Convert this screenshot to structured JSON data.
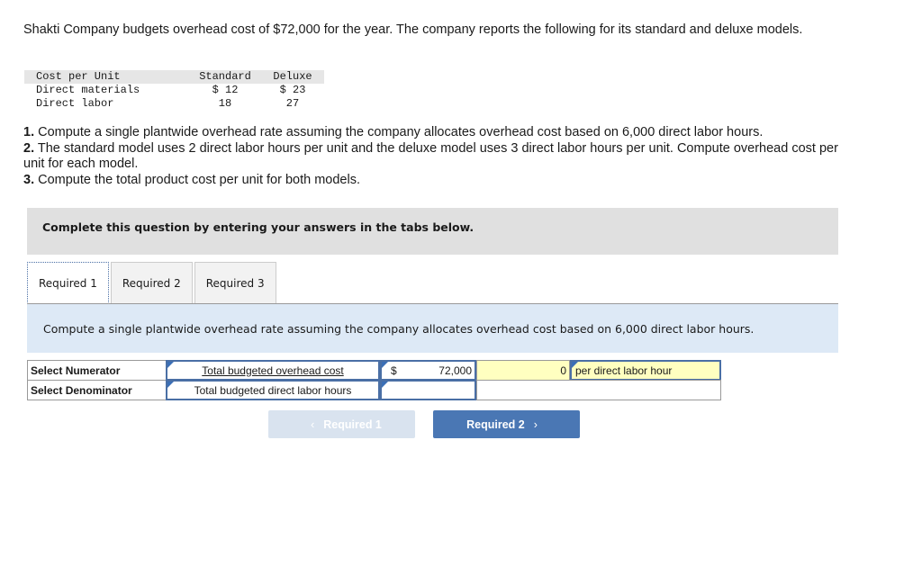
{
  "intro": "Shakti Company budgets overhead cost of $72,000 for the year. The company reports the following for its standard and deluxe models.",
  "cost_table": {
    "headers": [
      "Cost per Unit",
      "Standard",
      "Deluxe"
    ],
    "rows": [
      [
        "Direct materials",
        "$ 12",
        "$ 23"
      ],
      [
        "Direct labor",
        "18",
        "27"
      ]
    ]
  },
  "questions": [
    {
      "num": "1.",
      "text": " Compute a single plantwide overhead rate assuming the company allocates overhead cost based on 6,000 direct labor hours."
    },
    {
      "num": "2.",
      "text": " The standard model uses 2 direct labor hours per unit and the deluxe model uses 3 direct labor hours per unit. Compute overhead cost per unit for each model."
    },
    {
      "num": "3.",
      "text": " Compute the total product cost per unit for both models."
    }
  ],
  "banner": "Complete this question by entering your answers in the tabs below.",
  "tabs": [
    {
      "label": "Required 1",
      "active": true
    },
    {
      "label": "Required 2",
      "active": false
    },
    {
      "label": "Required 3",
      "active": false
    }
  ],
  "instruction": "Compute a single plantwide overhead rate assuming the company allocates overhead cost based on 6,000 direct labor hours.",
  "rate_grid": {
    "numerator_label": "Select Numerator",
    "numerator_select": "Total budgeted overhead cost",
    "numerator_currency": "$",
    "numerator_value": "72,000",
    "result_value": "0",
    "result_unit": "per direct labor hour",
    "denominator_label": "Select Denominator",
    "denominator_select": "Total budgeted direct labor hours",
    "denominator_value": ""
  },
  "nav": {
    "prev_label": "Required 1",
    "next_label": "Required 2",
    "prev_icon": "‹",
    "next_icon": "›"
  }
}
